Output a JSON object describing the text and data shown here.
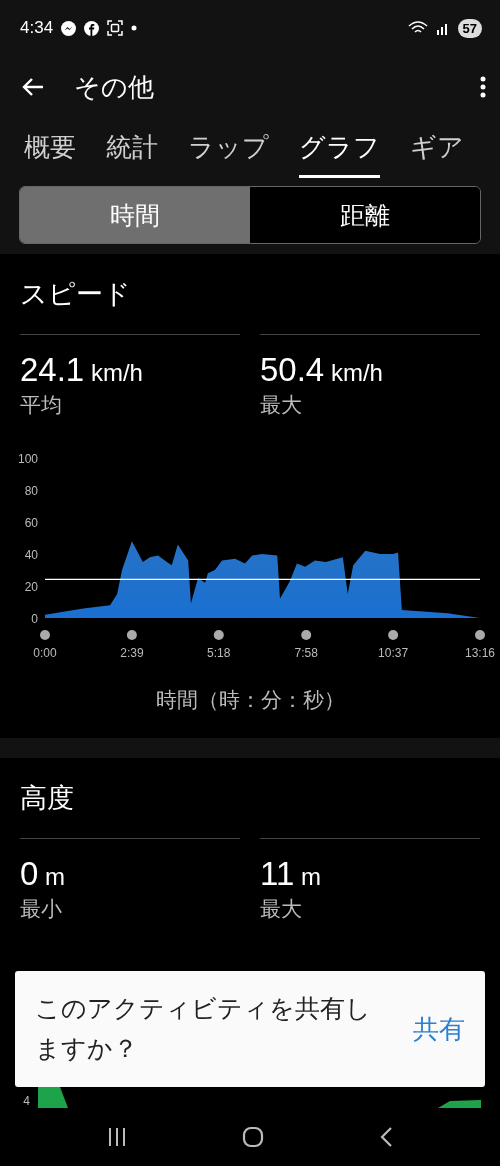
{
  "status_bar": {
    "time": "4:34",
    "battery": "57"
  },
  "app_bar": {
    "title": "その他"
  },
  "tabs": [
    {
      "label": "概要",
      "selected": false
    },
    {
      "label": "統計",
      "selected": false
    },
    {
      "label": "ラップ",
      "selected": false
    },
    {
      "label": "グラフ",
      "selected": true
    },
    {
      "label": "ギア",
      "selected": false
    }
  ],
  "segments": [
    {
      "label": "時間",
      "selected": true
    },
    {
      "label": "距離",
      "selected": false
    }
  ],
  "speed": {
    "title": "スピード",
    "stats": [
      {
        "value": "24.1",
        "unit": "km/h",
        "label": "平均"
      },
      {
        "value": "50.4",
        "unit": "km/h",
        "label": "最大"
      }
    ],
    "chart_data": {
      "type": "area",
      "x": [
        0,
        70,
        119,
        132,
        141,
        159,
        179,
        192,
        207,
        223,
        232,
        243,
        262,
        267,
        280,
        293,
        298,
        311,
        324,
        348,
        366,
        379,
        397,
        425,
        430,
        448,
        461,
        476,
        494,
        514,
        545,
        554,
        564,
        586,
        613,
        637,
        646,
        653,
        737,
        796
      ],
      "series": [
        {
          "color": "#2a7fdc",
          "values": [
            2,
            6,
            8,
            15,
            30,
            48,
            35,
            38,
            39,
            35,
            33,
            46,
            36,
            9,
            25,
            22,
            28,
            30,
            36,
            37,
            34,
            39,
            40,
            39,
            12,
            23,
            34,
            32,
            36,
            35,
            38,
            15,
            33,
            42,
            40,
            40,
            41,
            5,
            3,
            0
          ]
        }
      ],
      "xlim": [
        0,
        796
      ],
      "ylim": [
        0,
        100
      ],
      "xticks": [
        {
          "value": 0,
          "label": "0:00"
        },
        {
          "value": 159,
          "label": "2:39"
        },
        {
          "value": 318,
          "label": "5:18"
        },
        {
          "value": 478,
          "label": "7:58"
        },
        {
          "value": 637,
          "label": "10:37"
        },
        {
          "value": 796,
          "label": "13:16"
        }
      ],
      "yticks": [
        0,
        20,
        40,
        60,
        80,
        100
      ],
      "ref_lines": [
        {
          "axis": "y",
          "value": 24.1
        }
      ]
    },
    "axis_title": "時間（時：分：秒）"
  },
  "altitude": {
    "title": "高度",
    "stats": [
      {
        "value": "0",
        "unit": "m",
        "label": "最小"
      },
      {
        "value": "11",
        "unit": "m",
        "label": "最大"
      }
    ],
    "visible_tick": "4"
  },
  "toast": {
    "message": "このアクティビティを共有しますか？",
    "action": "共有"
  }
}
